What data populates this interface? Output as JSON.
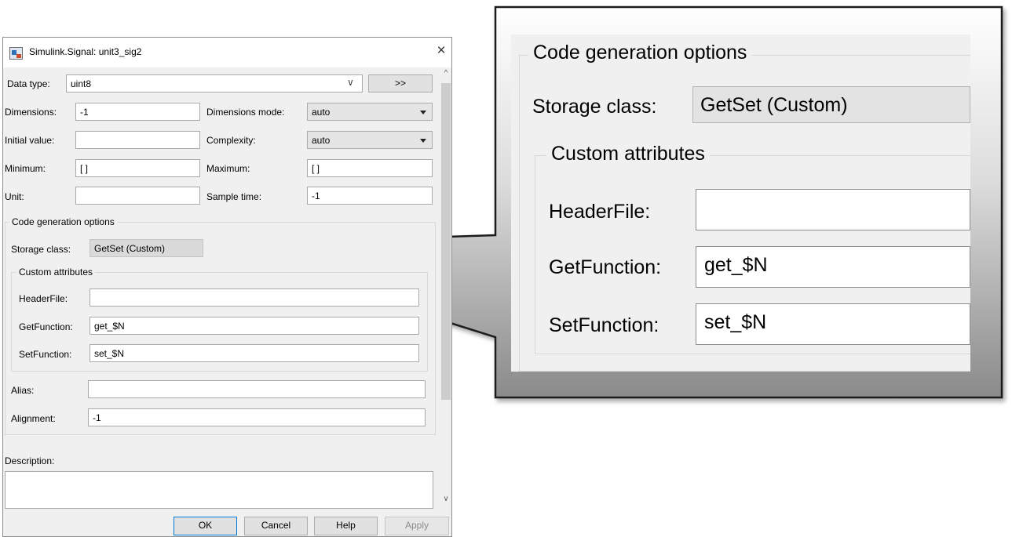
{
  "dialog": {
    "title": "Simulink.Signal: unit3_sig2",
    "close_glyph": "×",
    "data_type": {
      "label": "Data type:",
      "value": "uint8",
      "dropdown_glyph": "∨",
      "expand_button": ">>"
    },
    "dimensions": {
      "label": "Dimensions:",
      "value": "-1"
    },
    "dimensions_mode": {
      "label": "Dimensions mode:",
      "value": "auto"
    },
    "initial_value": {
      "label": "Initial value:",
      "value": ""
    },
    "complexity": {
      "label": "Complexity:",
      "value": "auto"
    },
    "minimum": {
      "label": "Minimum:",
      "value": "[ ]"
    },
    "maximum": {
      "label": "Maximum:",
      "value": "[ ]"
    },
    "unit": {
      "label": "Unit:",
      "value": ""
    },
    "sample_time": {
      "label": "Sample time:",
      "value": "-1"
    },
    "code_gen": {
      "title": "Code generation options",
      "storage_class": {
        "label": "Storage class:",
        "value": "GetSet (Custom)"
      },
      "custom_attributes": {
        "title": "Custom attributes",
        "header_file": {
          "label": "HeaderFile:",
          "value": ""
        },
        "get_function": {
          "label": "GetFunction:",
          "value": "get_$N"
        },
        "set_function": {
          "label": "SetFunction:",
          "value": "set_$N"
        }
      },
      "alias": {
        "label": "Alias:",
        "value": ""
      },
      "alignment": {
        "label": "Alignment:",
        "value": "-1"
      }
    },
    "description": {
      "label": "Description:",
      "value": ""
    },
    "buttons": {
      "ok": "OK",
      "cancel": "Cancel",
      "help": "Help",
      "apply": "Apply"
    },
    "scroll_up_glyph": "^",
    "scroll_down_glyph": "∨"
  },
  "zoom": {
    "title": "Code generation options",
    "storage_class": {
      "label": "Storage class:",
      "value": "GetSet (Custom)"
    },
    "custom_attributes": {
      "title": "Custom attributes",
      "header_file": {
        "label": "HeaderFile:",
        "value": ""
      },
      "get_function": {
        "label": "GetFunction:",
        "value": "get_$N"
      },
      "set_function": {
        "label": "SetFunction:",
        "value": "set_$N"
      }
    }
  },
  "colors": {
    "dialog_bg": "#f0f0f0",
    "callout_gradient_top": "#ffffff",
    "callout_gradient_bottom": "#8a8a8a",
    "callout_border": "#1f1f1f"
  }
}
